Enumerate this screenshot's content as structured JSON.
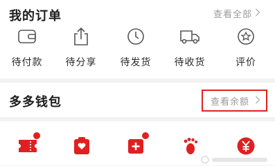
{
  "orders": {
    "title": "我的订单",
    "view_all": "查看全部",
    "items": [
      {
        "label": "待付款",
        "icon": "wallet-icon"
      },
      {
        "label": "待分享",
        "icon": "share-icon"
      },
      {
        "label": "待发货",
        "icon": "clock-icon"
      },
      {
        "label": "待收货",
        "icon": "truck-icon"
      },
      {
        "label": "评价",
        "icon": "review-star-icon"
      }
    ]
  },
  "wallet": {
    "title": "多多钱包",
    "check_balance": "查看余额"
  },
  "tools": {
    "items": [
      {
        "icon": "coupon-icon"
      },
      {
        "icon": "red-packet-icon"
      },
      {
        "icon": "medical-plus-icon"
      },
      {
        "icon": "footprint-icon"
      },
      {
        "icon": "yuan-coin-icon"
      }
    ]
  },
  "colors": {
    "accent": "#e02020",
    "text_secondary": "#9a9a9a",
    "background": "#f2f2f2"
  }
}
